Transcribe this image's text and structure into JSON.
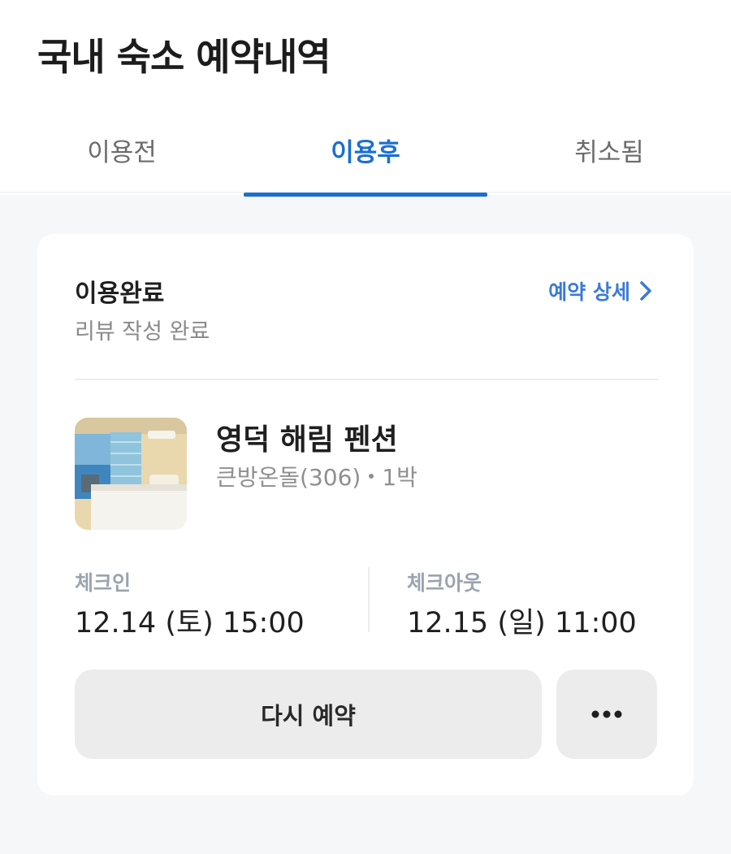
{
  "page": {
    "title": "국내 숙소 예약내역"
  },
  "tabs": [
    {
      "label": "이용전",
      "active": false
    },
    {
      "label": "이용후",
      "active": true
    },
    {
      "label": "취소됨",
      "active": false
    }
  ],
  "booking": {
    "status": "이용완료",
    "sub_status": "리뷰 작성 완료",
    "detail_link_label": "예약 상세",
    "hotel_name": "영덕 해림 펜션",
    "room_type": "큰방온돌(306)",
    "nights": "1박",
    "checkin_label": "체크인",
    "checkin_value": "12.14 (토) 15:00",
    "checkout_label": "체크아웃",
    "checkout_value": "12.15 (일) 11:00",
    "rebook_label": "다시 예약"
  },
  "colors": {
    "accent": "#1a6fd1",
    "link": "#3a7bd5",
    "background": "#f6f7f9",
    "button_bg": "#ececec"
  },
  "icons": {
    "detail_link": "chevron-right-icon",
    "more": "more-horizontal-icon"
  }
}
